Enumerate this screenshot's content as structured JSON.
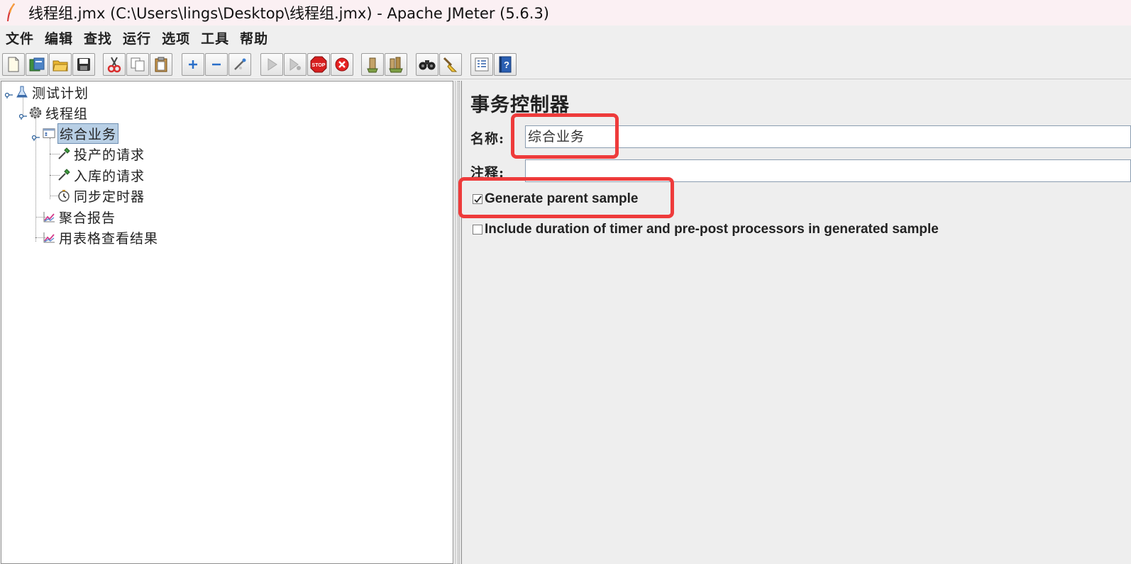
{
  "window": {
    "title": "线程组.jmx (C:\\Users\\lings\\Desktop\\线程组.jmx) - Apache JMeter (5.6.3)",
    "icon": "feather-icon"
  },
  "menubar": {
    "items": [
      "文件",
      "编辑",
      "查找",
      "运行",
      "选项",
      "工具",
      "帮助"
    ]
  },
  "toolbar": {
    "buttons": [
      {
        "name": "new-icon"
      },
      {
        "name": "templates-icon"
      },
      {
        "name": "open-icon"
      },
      {
        "name": "save-icon"
      },
      {
        "name": "cut-icon"
      },
      {
        "name": "copy-icon"
      },
      {
        "name": "paste-icon"
      },
      {
        "name": "expand-icon"
      },
      {
        "name": "collapse-icon"
      },
      {
        "name": "toggle-icon"
      },
      {
        "name": "start-icon"
      },
      {
        "name": "start-no-pause-icon"
      },
      {
        "name": "stop-icon"
      },
      {
        "name": "shutdown-icon"
      },
      {
        "name": "clear-icon"
      },
      {
        "name": "clear-all-icon"
      },
      {
        "name": "search-icon"
      },
      {
        "name": "reset-search-icon"
      },
      {
        "name": "function-helper-icon"
      },
      {
        "name": "help-icon"
      }
    ],
    "stop_label": "STOP"
  },
  "tree": {
    "items": [
      {
        "label": "测试计划",
        "icon": "test-plan-flask-icon",
        "level": 0
      },
      {
        "label": "线程组",
        "icon": "thread-group-gear-icon",
        "level": 1
      },
      {
        "label": "综合业务",
        "icon": "transaction-controller-icon",
        "level": 2,
        "selected": true
      },
      {
        "label": "投产的请求",
        "icon": "sampler-pipette-icon",
        "level": 3
      },
      {
        "label": "入库的请求",
        "icon": "sampler-pipette-icon",
        "level": 3
      },
      {
        "label": "同步定时器",
        "icon": "timer-clock-icon",
        "level": 3
      },
      {
        "label": "聚合报告",
        "icon": "listener-chart-icon",
        "level": 2
      },
      {
        "label": "用表格查看结果",
        "icon": "listener-chart-icon",
        "level": 2
      }
    ]
  },
  "panel": {
    "title": "事务控制器",
    "name_label": "名称:",
    "name_value": "综合业务",
    "comment_label": "注释:",
    "comment_value": "",
    "generate_parent_sample": {
      "label": "Generate parent sample",
      "checked": true
    },
    "include_duration": {
      "label": "Include duration of timer and pre-post processors in generated sample",
      "checked": false
    }
  },
  "annotations": {
    "highlight_color": "#ee3b3b"
  }
}
